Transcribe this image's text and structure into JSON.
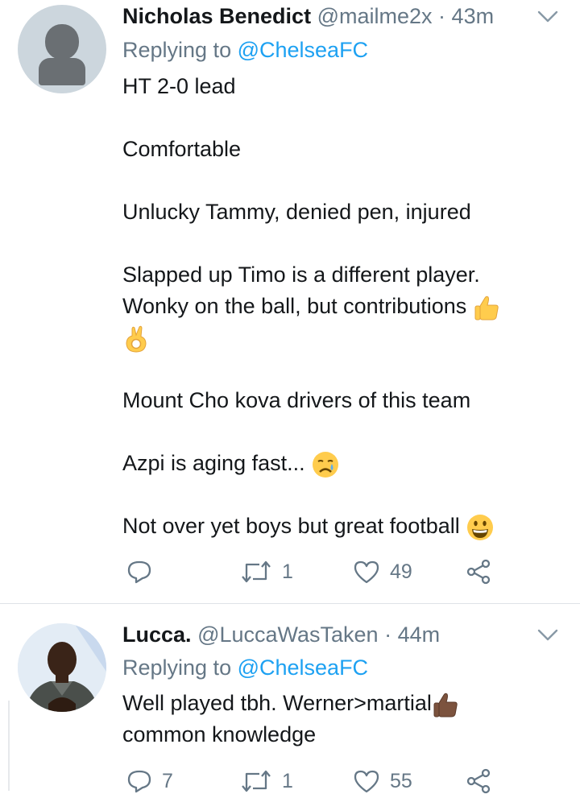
{
  "tweets": [
    {
      "name": "Nicholas Benedict",
      "handle": "@mailme2x",
      "separator": "·",
      "time": "43m",
      "replying_prefix": "Replying to ",
      "replying_to": "@ChelseaFC",
      "lines": {
        "l1": "HT 2-0 lead",
        "l2": "Comfortable",
        "l3": "Unlucky Tammy, denied pen, injured",
        "l4": "Slapped up Timo is a different player.",
        "l5": "Wonky on the ball, but contributions",
        "l6": "Mount Cho kova drivers of this team",
        "l7": "Azpi is aging fast...",
        "l8": "Not over yet boys but great football"
      },
      "icons": [
        "thumbs-up-icon",
        "ok-hand-icon",
        "crying-face-icon",
        "grinning-face-icon"
      ],
      "replies": "",
      "retweets": "1",
      "likes": "49"
    },
    {
      "name": "Lucca.",
      "handle": "@LuccaWasTaken",
      "separator": "·",
      "time": "44m",
      "replying_prefix": "Replying to ",
      "replying_to": "@ChelseaFC",
      "lines": {
        "l1": "Well played tbh. Werner>martial",
        "l2": "common knowledge"
      },
      "icons": [
        "thumbs-up-dark-icon"
      ],
      "replies": "7",
      "retweets": "1",
      "likes": "55"
    }
  ],
  "colors": {
    "text": "#14171a",
    "secondary": "#657786",
    "link": "#1da1f2",
    "divider": "#dfe3e7"
  }
}
